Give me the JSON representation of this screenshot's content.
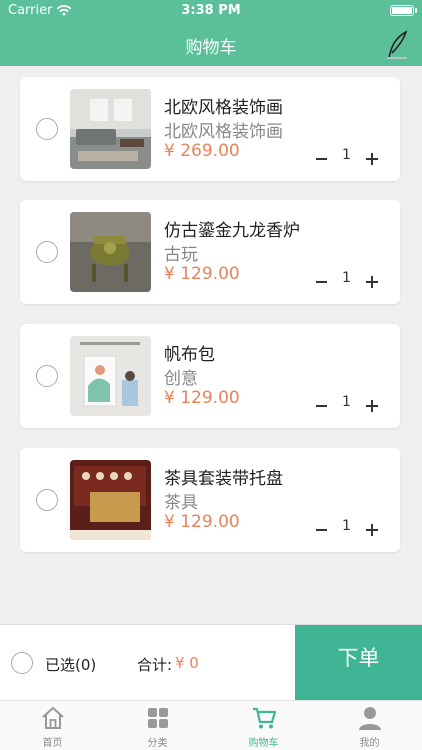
{
  "status_bar": {
    "carrier": "Carrier",
    "time": "3:38 PM"
  },
  "header": {
    "title": "购物车",
    "edit_icon": "pen-icon"
  },
  "cart_items": [
    {
      "name": "北欧风格装饰画",
      "subtitle": "北欧风格装饰画",
      "price": "¥ 269.00",
      "qty": "1"
    },
    {
      "name": "仿古鎏金九龙香炉",
      "subtitle": "古玩",
      "price": "¥ 129.00",
      "qty": "1"
    },
    {
      "name": "帆布包",
      "subtitle": "创意",
      "price": "¥ 129.00",
      "qty": "1"
    },
    {
      "name": "茶具套装带托盘",
      "subtitle": "茶具",
      "price": "¥ 129.00",
      "qty": "1"
    }
  ],
  "checkout": {
    "selected_label": "已选(0)",
    "total_label": "合计:",
    "total_value": "¥ 0",
    "order_button": "下单"
  },
  "tabs": [
    {
      "label": "首页",
      "icon": "home-icon"
    },
    {
      "label": "分类",
      "icon": "grid-icon"
    },
    {
      "label": "购物车",
      "icon": "cart-icon",
      "active": true
    },
    {
      "label": "我的",
      "icon": "user-icon"
    }
  ],
  "colors": {
    "accent": "#5bbf9a",
    "button": "#3fb596",
    "price": "#e8835a"
  }
}
